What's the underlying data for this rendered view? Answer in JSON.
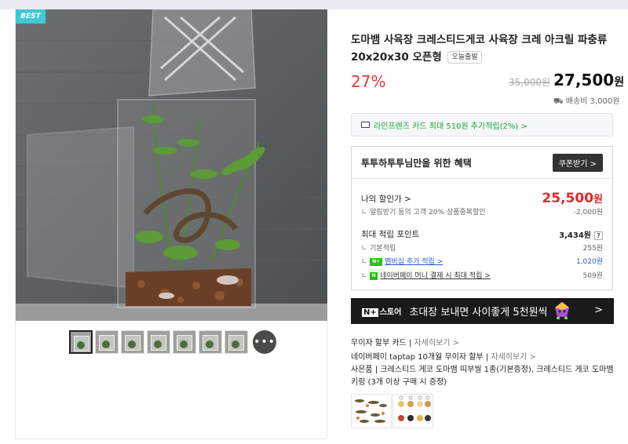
{
  "gallery": {
    "badge": "BEST",
    "more_label": "•••"
  },
  "product": {
    "title": "도마뱀 사육장 크레스티드게코 사육장 크레 아크릴 파충류 20x20x30 오픈형",
    "today_badge": "오늘출발",
    "discount": "27%",
    "original_price": "35,000원",
    "price": "27,500",
    "price_unit": "원",
    "shipping": "배송비 3,000원"
  },
  "card_banner": "라인프렌즈 카드 최대 510원 추가적립(2%) >",
  "benefit": {
    "title": "투투하투투님만을 위한 혜택",
    "coupon_button": "쿠폰받기 >",
    "my_discount_label": "나의 할인가 >",
    "my_discount_price": "25,500",
    "my_discount_unit": "원",
    "alarm_label": "알림받기 동의 고객 20% 상품중복할인",
    "alarm_value": "-2,000원",
    "points_label": "최대 적립 포인트",
    "points_value": "3,434원",
    "points_help": "?",
    "basic_label": "기본적립",
    "basic_value": "255원",
    "membership_badge": "N+",
    "membership_label": "멤버십 추가 적립 >",
    "membership_value": "1,020원",
    "npay_badge": "N",
    "npay_label": "네이버페이 머니 결제 시 최대 적립 >",
    "npay_value": "509원"
  },
  "promo": {
    "logo_badge": "N+",
    "logo_text": "스토어",
    "text": "초대장 보내면 사이좋게 5천원씩",
    "chevron": ">"
  },
  "info": {
    "no_interest_label": "무이자 할부 카드",
    "no_interest_link": "자세히보기 >",
    "npay_installment": "네이버페이 taptap 10개월 무이자 할부",
    "npay_installment_link": "자세히보기 >",
    "gift_label": "사은품",
    "gift_text": "크레스티드 게코 도마뱀 띠부씰 1종(기본증정), 크레스티드 게코 도마뱀 키링 (3개 이상 구매 시 증정)"
  },
  "colors": {
    "accent_red": "#e53a3a",
    "naver_green": "#1ec800",
    "best_badge": "#3ec9d6"
  }
}
